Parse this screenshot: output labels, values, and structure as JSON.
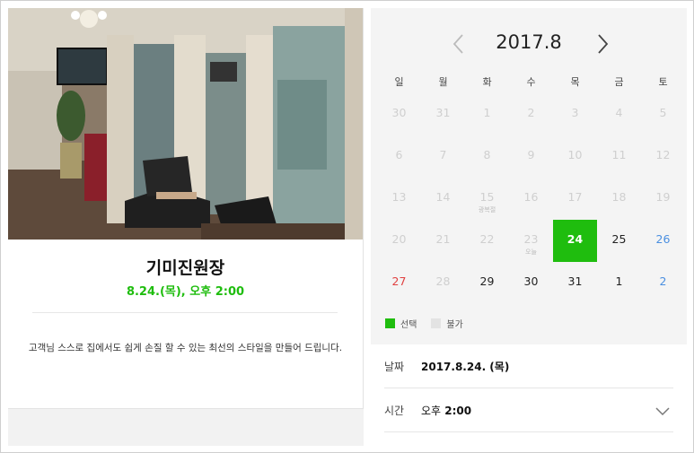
{
  "salon": {
    "name": "기미진원장",
    "datetime": "8.24.(목), 오후 2:00",
    "description": "고객님 스스로 집에서도 쉽게 손질 할 수 있는 최선의 스타일을 만들어 드립니다."
  },
  "calendar": {
    "month_label": "2017.8",
    "weekdays": [
      "일",
      "월",
      "화",
      "수",
      "목",
      "금",
      "토"
    ],
    "days": [
      {
        "label": "30",
        "state": "disabled"
      },
      {
        "label": "31",
        "state": "disabled"
      },
      {
        "label": "1",
        "state": "disabled"
      },
      {
        "label": "2",
        "state": "disabled"
      },
      {
        "label": "3",
        "state": "disabled"
      },
      {
        "label": "4",
        "state": "disabled"
      },
      {
        "label": "5",
        "state": "disabled"
      },
      {
        "label": "6",
        "state": "disabled"
      },
      {
        "label": "7",
        "state": "disabled"
      },
      {
        "label": "8",
        "state": "disabled"
      },
      {
        "label": "9",
        "state": "disabled"
      },
      {
        "label": "10",
        "state": "disabled"
      },
      {
        "label": "11",
        "state": "disabled"
      },
      {
        "label": "12",
        "state": "disabled"
      },
      {
        "label": "13",
        "state": "disabled"
      },
      {
        "label": "14",
        "state": "disabled"
      },
      {
        "label": "15",
        "state": "disabled",
        "sub": "광복절"
      },
      {
        "label": "16",
        "state": "disabled"
      },
      {
        "label": "17",
        "state": "disabled"
      },
      {
        "label": "18",
        "state": "disabled"
      },
      {
        "label": "19",
        "state": "disabled"
      },
      {
        "label": "20",
        "state": "disabled"
      },
      {
        "label": "21",
        "state": "disabled"
      },
      {
        "label": "22",
        "state": "disabled"
      },
      {
        "label": "23",
        "state": "disabled",
        "sub": "오늘"
      },
      {
        "label": "24",
        "state": "selected"
      },
      {
        "label": "25",
        "state": "active"
      },
      {
        "label": "26",
        "state": "sat"
      },
      {
        "label": "27",
        "state": "sun"
      },
      {
        "label": "28",
        "state": "disabled"
      },
      {
        "label": "29",
        "state": "active"
      },
      {
        "label": "30",
        "state": "active"
      },
      {
        "label": "31",
        "state": "active"
      },
      {
        "label": "1",
        "state": "active"
      },
      {
        "label": "2",
        "state": "sat"
      }
    ],
    "legend": {
      "selected": "선택",
      "unavailable": "불가"
    }
  },
  "booking": {
    "date_label": "날짜",
    "date_value": "2017.8.24. (목)",
    "time_label": "시간",
    "time_prefix": "오후",
    "time_value": "2:00"
  },
  "colors": {
    "accent": "#1fbd0e",
    "saturday": "#4a8fe0",
    "sunday": "#e04040"
  },
  "icons": {
    "prev": "chevron-left-icon",
    "next": "chevron-right-icon",
    "dropdown": "chevron-down-icon"
  }
}
